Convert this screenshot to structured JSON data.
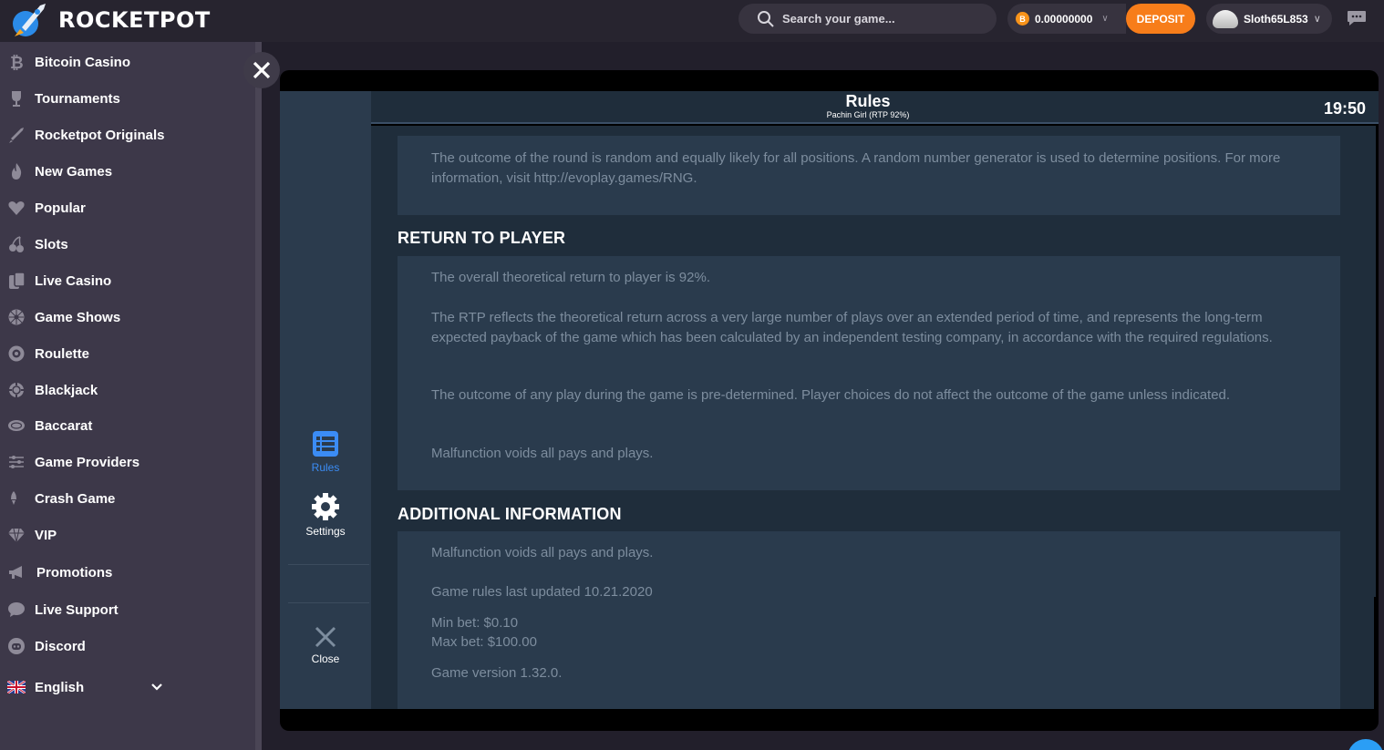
{
  "brand": {
    "name": "ROCKETPOT"
  },
  "search": {
    "placeholder": "Search your game..."
  },
  "wallet": {
    "balance": "0.00000000",
    "currency_symbol": "B",
    "deposit_label": "DEPOSIT"
  },
  "user": {
    "username": "Sloth65L853"
  },
  "sidebar": {
    "items": [
      {
        "label": "Bitcoin Casino",
        "icon": "bitcoin-icon"
      },
      {
        "label": "Tournaments",
        "icon": "trophy-icon"
      },
      {
        "label": "Rocketpot Originals",
        "icon": "rocket-icon"
      },
      {
        "label": "New Games",
        "icon": "flame-icon"
      },
      {
        "label": "Popular",
        "icon": "heart-icon"
      },
      {
        "label": "Slots",
        "icon": "cherries-icon"
      },
      {
        "label": "Live Casino",
        "icon": "cards-icon"
      },
      {
        "label": "Game Shows",
        "icon": "wheel-icon"
      },
      {
        "label": "Roulette",
        "icon": "roulette-icon"
      },
      {
        "label": "Blackjack",
        "icon": "chip-icon"
      },
      {
        "label": "Baccarat",
        "icon": "table-icon"
      },
      {
        "label": "Game Providers",
        "icon": "sliders-icon"
      },
      {
        "label": "Crash Game",
        "icon": "crash-rocket-icon"
      },
      {
        "label": "VIP",
        "icon": "diamond-icon"
      },
      {
        "label": "Promotions",
        "icon": "megaphone-icon"
      },
      {
        "label": "Live Support",
        "icon": "chat-bubble-icon"
      },
      {
        "label": "Discord",
        "icon": "discord-icon"
      }
    ],
    "language": {
      "label": "English",
      "icon": "uk-flag-icon"
    }
  },
  "rules_panel": {
    "title": "Rules",
    "subtitle": "Pachin Girl (RTP 92%)",
    "clock": "19:50",
    "nav": [
      {
        "label": "Rules",
        "active": true
      },
      {
        "label": "Settings",
        "active": false
      },
      {
        "label": "Close",
        "active": false
      }
    ],
    "intro_text": "The outcome of the round is random and equally likely for all positions. A random number generator is used to determine positions. For more information, visit http://evoplay.games/RNG.",
    "sections": [
      {
        "heading": "RETURN TO PLAYER",
        "paragraphs": [
          "The overall theoretical return to player is 92%.",
          "The RTP reflects the theoretical return across a very large number of plays over an extended period of time, and represents the long-term expected payback of the game which has been calculated by an independent testing company, in accordance with the required regulations.",
          "The outcome of any play during the game is pre-determined. Player choices do not affect the outcome of the game unless indicated.",
          "Malfunction voids all pays and plays."
        ]
      },
      {
        "heading": "ADDITIONAL INFORMATION",
        "paragraphs": [
          "Malfunction voids all pays and plays.",
          "Game rules last updated 10.21.2020",
          "Min bet: $0.10",
          "Max bet: $100.00",
          "Game version 1.32.0."
        ]
      }
    ]
  },
  "colors": {
    "accent": "#f77d1a",
    "active_nav": "#3b8cf5",
    "panel_bg": "#1f2d3b",
    "block_bg": "#2a3b4d",
    "body_text": "#7d8d9e"
  }
}
